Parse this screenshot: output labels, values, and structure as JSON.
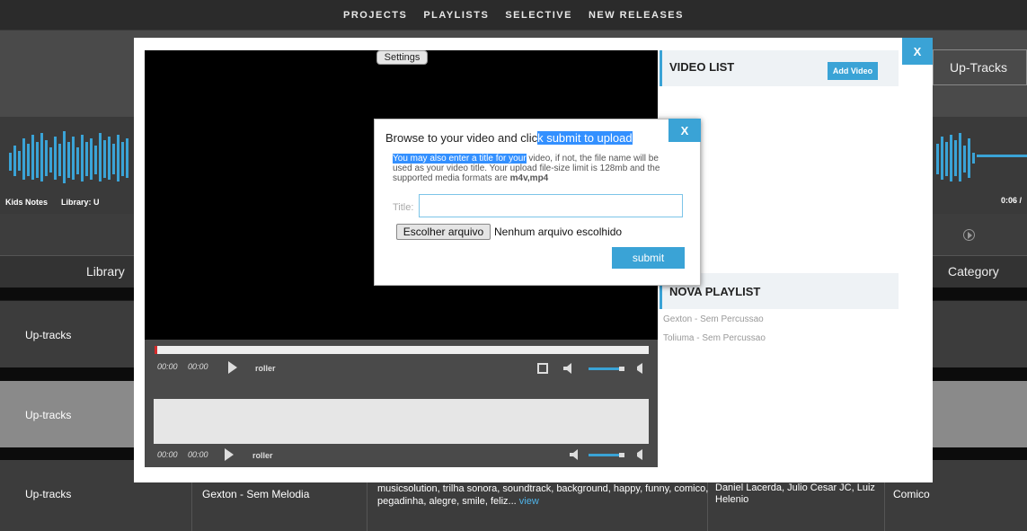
{
  "nav": {
    "items": [
      "PROJECTS",
      "PLAYLISTS",
      "SELECTIVE",
      "NEW RELEASES"
    ]
  },
  "background": {
    "uptracks_button": "Up-Tracks",
    "track_info": {
      "name": "Kids Notes",
      "library_prefix": "Library: U",
      "time": "0:06 /"
    },
    "columns": {
      "library": "Library",
      "category": "Category"
    },
    "rows": [
      {
        "library": "Up-tracks"
      },
      {
        "library": "Up-tracks"
      },
      {
        "library": "Up-tracks",
        "track": "Gexton - Sem Melodia",
        "tags": "musicsolution, trilha sonora, soundtrack, background, happy, funny, comico, pegadinha, alegre, smile, feliz...",
        "view_link": "view",
        "authors": "Daniel Lacerda, Julio Cesar JC, Luiz Helenio",
        "category": "Comico"
      }
    ]
  },
  "modal": {
    "close": "X",
    "settings": "Settings",
    "player1": {
      "current": "00:00",
      "duration": "00:00",
      "title": "roller"
    },
    "player2": {
      "current": "00:00",
      "duration": "00:00",
      "title": "roller"
    },
    "video_list": {
      "title": "VIDEO LIST",
      "add_button": "Add Video"
    },
    "playlist": {
      "title": "NOVA PLAYLIST",
      "items": [
        "Gexton - Sem Percussao",
        "Toliuma - Sem Percussao"
      ]
    }
  },
  "upload": {
    "close": "X",
    "heading_a": "Browse to your video and clic",
    "heading_b": "k submit to upload",
    "desc_a": "You may also enter a title for your",
    "desc_b": " video, if not, the file name will be used as your video title. Your upload file-size limit is 128mb and the supported media formats are ",
    "desc_formats": "m4v,mp4",
    "title_label": "Title:",
    "title_value": "",
    "choose_file": "Escolher arquivo",
    "no_file": "Nenhum arquivo escolhido",
    "submit": "submit"
  },
  "colors": {
    "accent": "#3aa3d6",
    "progress": "#d42b2b",
    "highlight": "#3390ff"
  }
}
